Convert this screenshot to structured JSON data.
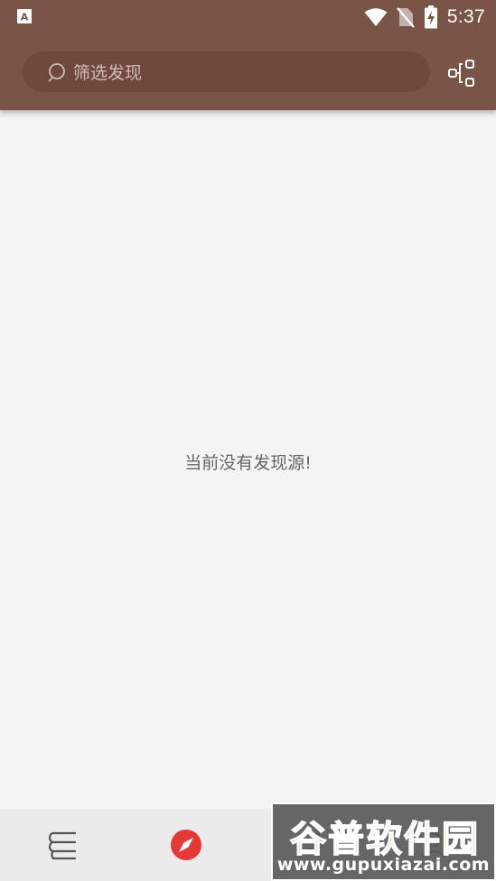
{
  "status_bar": {
    "time": "5:37",
    "icons": [
      "notification-a-icon",
      "wifi-icon",
      "no-sim-icon",
      "battery-charging-icon"
    ]
  },
  "toolbar": {
    "search_placeholder": "筛选发现",
    "share_icon": "share-config-icon"
  },
  "content": {
    "empty_message": "当前没有发现源!"
  },
  "bottom_nav": {
    "items": [
      {
        "icon": "bookshelf-icon",
        "active": false
      },
      {
        "icon": "compass-icon",
        "active": true
      },
      {
        "icon": "rss-icon",
        "active": false
      },
      {
        "icon": "profile-icon",
        "active": false
      }
    ],
    "active_color": "#e53935"
  },
  "watermark": {
    "title": "谷普软件园",
    "url": "www.gupuxiazai.com"
  },
  "colors": {
    "primary": "#7a5446",
    "search_bg": "#6e4a3d",
    "background": "#f4f4f4"
  }
}
